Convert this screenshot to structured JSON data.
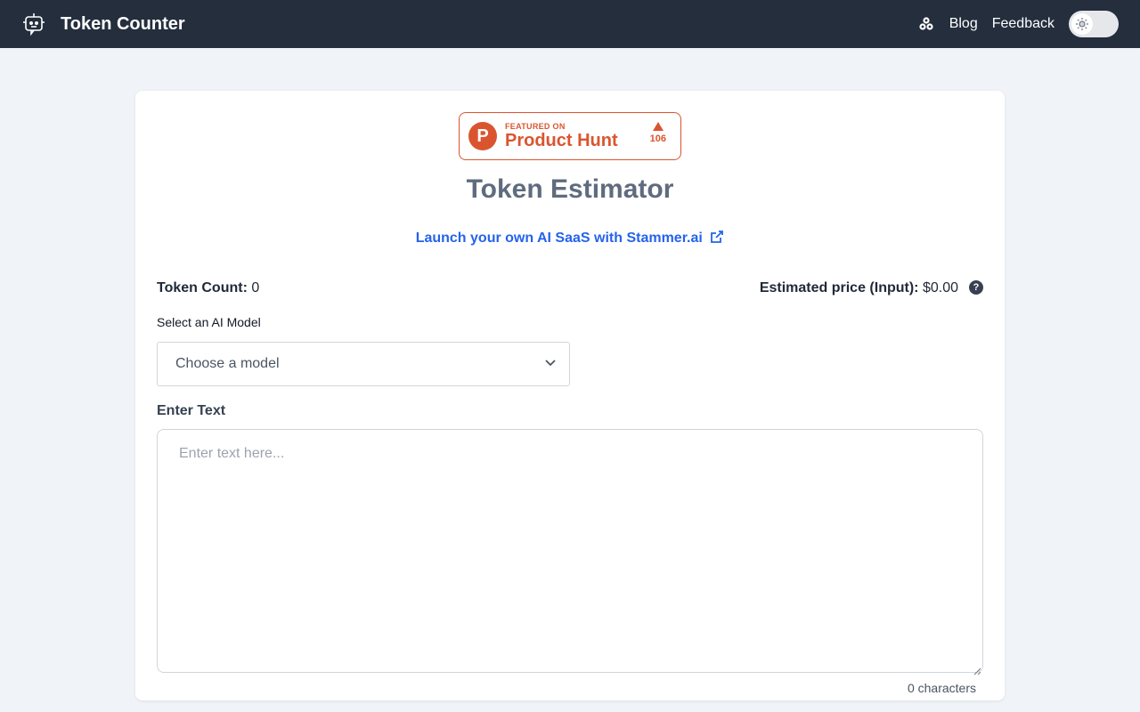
{
  "navbar": {
    "brand_title": "Token Counter",
    "brand_icon": "robot-icon",
    "links": [
      "Blog",
      "Feedback"
    ],
    "github_icon": "github-icon",
    "theme_toggle_icon": "sun-icon"
  },
  "badge": {
    "featured": "FEATURED ON",
    "name": "Product Hunt",
    "votes": "106",
    "logo_letter": "P",
    "color": "#da552f"
  },
  "main": {
    "title": "Token Estimator",
    "promo_link": "Launch your own AI SaaS with Stammer.ai",
    "token_count_label": "Token Count:",
    "token_count_value": "0",
    "price_label": "Estimated price (Input):",
    "price_value": "$0.00",
    "model_label": "Select an AI Model",
    "model_placeholder": "Choose a model",
    "text_label": "Enter Text",
    "text_placeholder": "Enter text here...",
    "char_count": "0 characters"
  },
  "colors": {
    "navbar_bg": "#242e3d",
    "link_blue": "#2563eb",
    "page_bg": "#f0f3f7"
  }
}
